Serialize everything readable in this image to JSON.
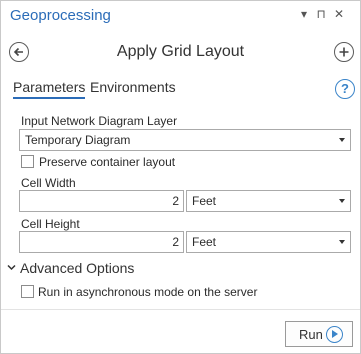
{
  "pane": {
    "title": "Geoprocessing",
    "controls": {
      "dropdown": "▾",
      "pin": "⊓",
      "close": "✕"
    }
  },
  "tool": {
    "title": "Apply Grid Layout",
    "back_icon": "back-arrow-circle",
    "add_icon": "plus-circle"
  },
  "tabs": [
    {
      "label": "Parameters",
      "active": true
    },
    {
      "label": "Environments",
      "active": false
    }
  ],
  "help": {
    "label": "?"
  },
  "params": {
    "input_layer": {
      "label": "Input Network Diagram Layer",
      "value": "Temporary Diagram"
    },
    "preserve": {
      "label": "Preserve container layout",
      "checked": false
    },
    "cell_width": {
      "label": "Cell Width",
      "value": "2",
      "unit": "Feet"
    },
    "cell_height": {
      "label": "Cell Height",
      "value": "2",
      "unit": "Feet"
    }
  },
  "advanced": {
    "label": "Advanced Options",
    "expanded": true,
    "async": {
      "label": "Run in asynchronous mode on the server",
      "checked": false
    }
  },
  "run": {
    "label": "Run"
  },
  "colors": {
    "accent": "#2b6cb8",
    "border": "#aaaaaa"
  }
}
